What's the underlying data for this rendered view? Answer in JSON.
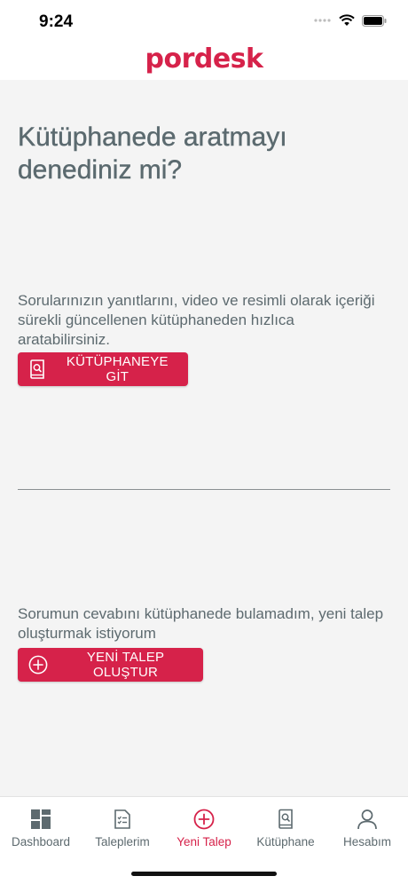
{
  "status_bar": {
    "time": "9:24"
  },
  "header": {
    "logo_text": "pordesk"
  },
  "main": {
    "headline": "Kütüphanede aratmayı denediniz mi?",
    "library_description": "Sorularınızın yanıtlarını, video ve resimli olarak içeriği sürekli güncellenen kütüphaneden hızlıca aratabilirsiniz.",
    "library_button_label": "KÜTÜPHANEYE GİT",
    "new_request_description": "Sorumun cevabını kütüphanede bulamadım, yeni talep oluşturmak istiyorum",
    "new_request_button_label": "YENİ TALEP OLUŞTUR"
  },
  "tab_bar": {
    "items": [
      {
        "label": "Dashboard",
        "icon": "dashboard-icon"
      },
      {
        "label": "Taleplerim",
        "icon": "list-icon"
      },
      {
        "label": "Yeni Talep",
        "icon": "plus-circle-icon",
        "active": true
      },
      {
        "label": "Kütüphane",
        "icon": "library-icon"
      },
      {
        "label": "Hesabım",
        "icon": "user-icon"
      }
    ]
  },
  "colors": {
    "brand": "#d6224a",
    "text": "#5d6a6f",
    "background": "#f4f4f4"
  }
}
